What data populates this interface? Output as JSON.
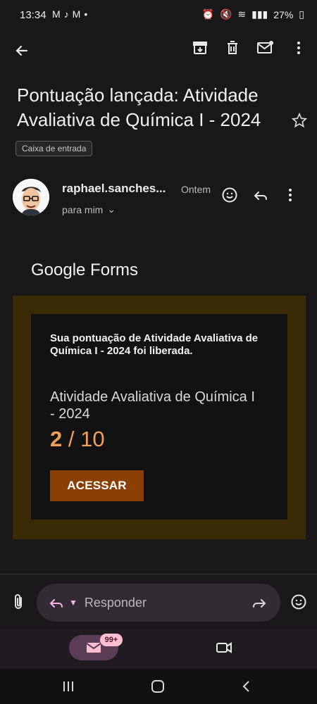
{
  "status_bar": {
    "time": "13:34",
    "battery": "27%",
    "apps": [
      "gmail-icon",
      "tiktok-icon",
      "gmail-icon"
    ],
    "indicators": [
      "alarm-icon",
      "mute-icon",
      "wifi-icon",
      "signal-icon",
      "battery-icon"
    ]
  },
  "toolbar": {
    "back": "back-icon",
    "actions": [
      "archive-icon",
      "delete-icon",
      "mark-unread-icon",
      "more-icon"
    ]
  },
  "email": {
    "subject": "Pontuação lançada: Atividade Avaliativa de Química I - 2024",
    "label": "Caixa de entrada",
    "sender": "raphael.sanches...",
    "date": "Ontem",
    "recipient": "para mim"
  },
  "content": {
    "logo": "Google Forms",
    "notice": "Sua pontuação de Atividade Avaliativa de Química I - 2024 foi liberada.",
    "form_title": "Atividade Avaliativa de Química I - 2024",
    "score": "2",
    "score_separator": "/",
    "total": "10",
    "button": "ACESSAR"
  },
  "reply": {
    "placeholder": "Responder"
  },
  "bottom_nav": {
    "badge": "99+"
  },
  "colors": {
    "background": "#181818",
    "card_border": "#392b06",
    "card_background": "#121212",
    "score": "#f1a05b",
    "button": "#8a4003",
    "reply_bar": "#332b33",
    "mail_pill": "#5b3e56",
    "badge": "#ffbfd0"
  }
}
